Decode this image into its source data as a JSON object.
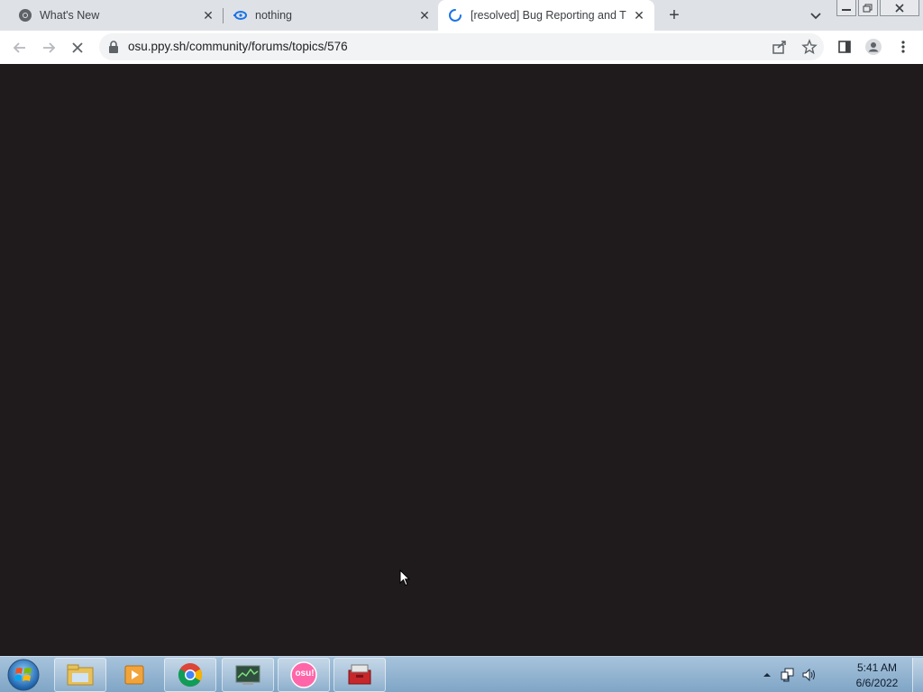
{
  "browser": {
    "tabs": [
      {
        "title": "What's New",
        "icon": "chrome-icon"
      },
      {
        "title": "nothing",
        "icon": "site-favicon"
      },
      {
        "title": "[resolved] Bug Reporting and Tro",
        "icon": "loading-spinner-icon"
      }
    ],
    "new_tab_label": "+",
    "url": "osu.ppy.sh/community/forums/topics/576"
  },
  "taskbar": {
    "apps": [
      "file-explorer",
      "media-player",
      "chrome",
      "system-monitor",
      "osu",
      "toolbox"
    ],
    "osu_label": "osu!",
    "clock": {
      "time": "5:41 AM",
      "date": "6/6/2022"
    }
  },
  "colors": {
    "page_background": "#1f1a1b",
    "tabstrip": "#dee1e6",
    "accent_blue": "#1a73e8",
    "osu_pink": "#ff66aa"
  }
}
